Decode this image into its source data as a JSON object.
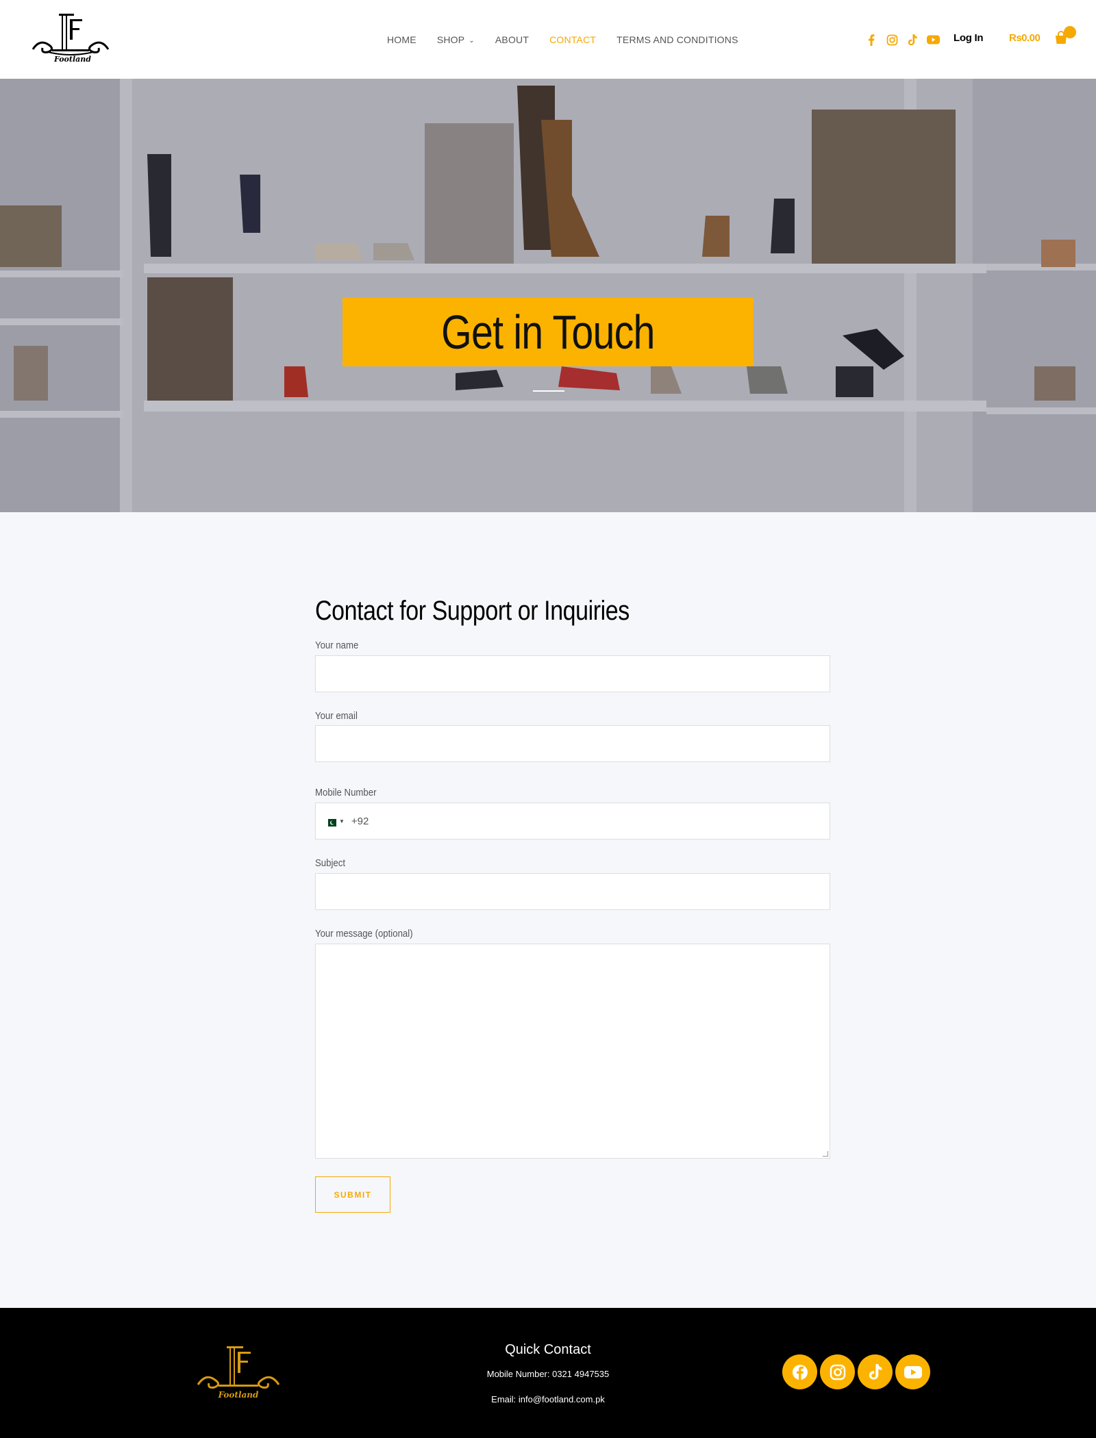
{
  "header": {
    "logo_text": "Footland",
    "nav": [
      {
        "label": "HOME"
      },
      {
        "label": "SHOP"
      },
      {
        "label": "ABOUT"
      },
      {
        "label": "CONTACT"
      },
      {
        "label": "TERMS AND CONDITIONS"
      }
    ],
    "social_icons": [
      "facebook-icon",
      "instagram-icon",
      "tiktok-icon",
      "youtube-icon"
    ],
    "login_label": "Log In",
    "cart_total": "Rs0.00"
  },
  "hero": {
    "title": "Get in Touch"
  },
  "form": {
    "title": "Contact for Support or Inquiries",
    "fields": {
      "name_label": "Your name",
      "email_label": "Your email",
      "mobile_label": "Mobile Number",
      "mobile_prefix": "+92",
      "subject_label": "Subject",
      "message_label": "Your message (optional)"
    },
    "submit_label": "SUBMIT"
  },
  "footer": {
    "logo_text": "Footland",
    "quick_contact_title": "Quick Contact",
    "mobile_line": "Mobile Number: 0321 4947535",
    "email_line": "Email: info@footland.com.pk",
    "social_icons": [
      "facebook-icon",
      "instagram-icon",
      "tiktok-icon",
      "youtube-icon"
    ]
  },
  "colors": {
    "accent": "#fcb300",
    "accent_text": "#f5a904",
    "footer_bg": "#000000",
    "page_bg": "#f6f7fb"
  }
}
